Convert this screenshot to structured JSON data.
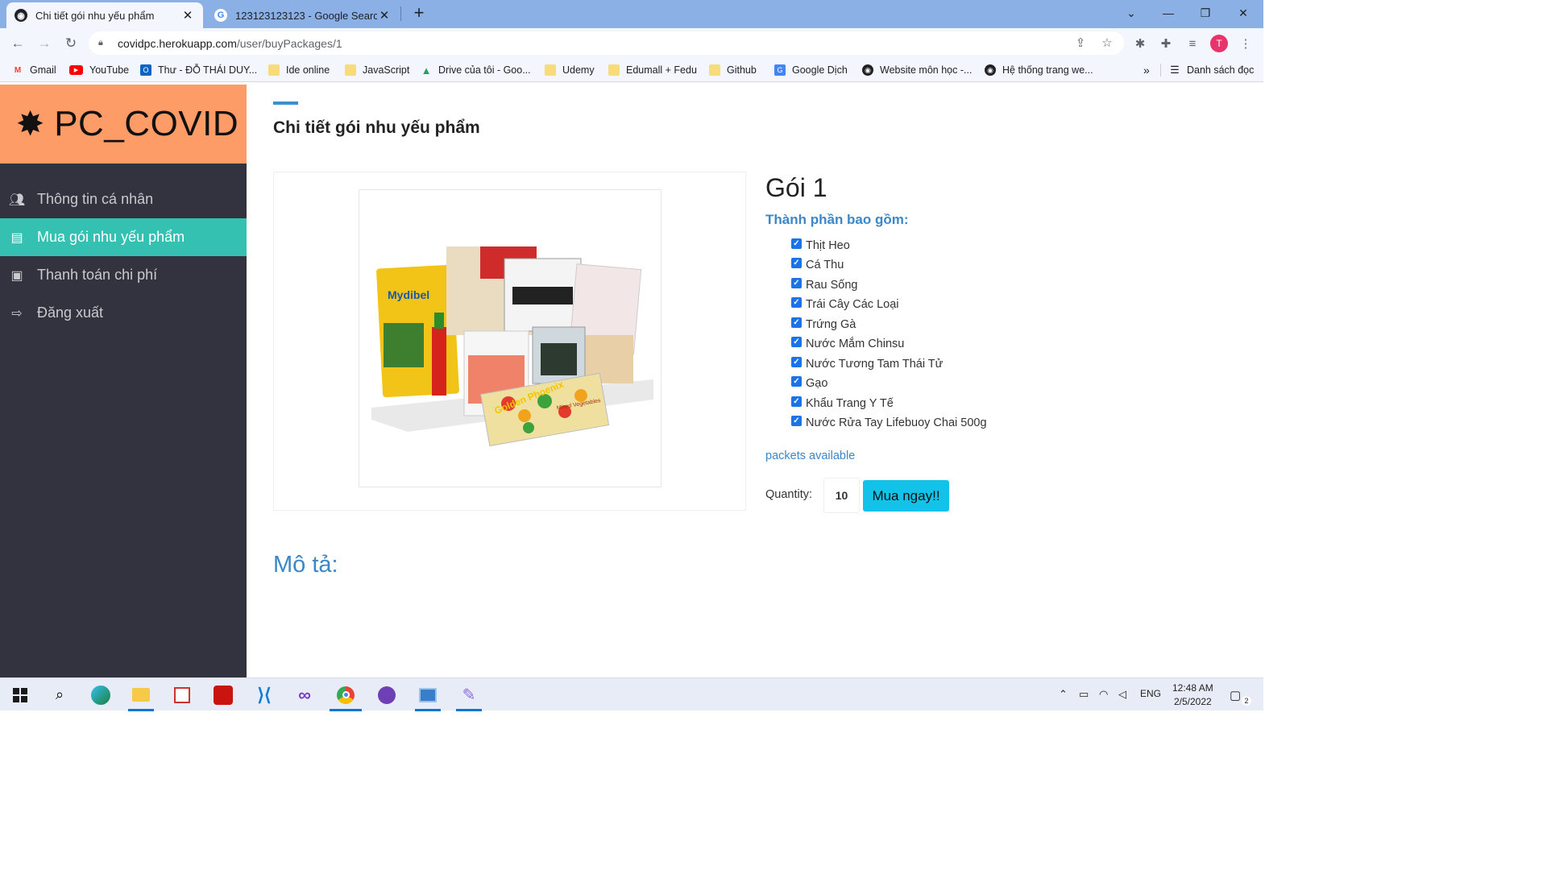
{
  "browser": {
    "tabs": [
      {
        "title": "Chi tiết gói nhu yếu phẩm",
        "active": true
      },
      {
        "title": "123123123123 - Google Search",
        "active": false
      }
    ],
    "new_tab": "+",
    "url_host": "covidpc.herokuapp.com",
    "url_path": "/user/buyPackages/1",
    "profile_initial": "T",
    "bookmarks": [
      {
        "label": "Gmail",
        "icon": "gmail-icon"
      },
      {
        "label": "YouTube",
        "icon": "youtube-icon"
      },
      {
        "label": "Thư - ĐỖ THÁI DUY...",
        "icon": "outlook-icon"
      },
      {
        "label": "Ide online",
        "icon": "folder-icon"
      },
      {
        "label": "JavaScript",
        "icon": "folder-icon"
      },
      {
        "label": "Drive của tôi - Goo...",
        "icon": "drive-icon"
      },
      {
        "label": "Udemy",
        "icon": "folder-icon"
      },
      {
        "label": "Edumall + Fedu",
        "icon": "folder-icon"
      },
      {
        "label": "Github",
        "icon": "folder-icon"
      },
      {
        "label": "Google Dịch",
        "icon": "translate-icon"
      },
      {
        "label": "Website môn học -...",
        "icon": "globe-icon"
      },
      {
        "label": "Hệ thống trang we...",
        "icon": "globe-icon"
      }
    ],
    "more": "»",
    "reading_list": "Danh sách đọc"
  },
  "sidebar": {
    "brand": "PC_COVID",
    "items": [
      {
        "label": "Thông tin cá nhân",
        "icon": "users-icon",
        "active": false
      },
      {
        "label": "Mua gói nhu yếu phẩm",
        "icon": "archive-icon",
        "active": true
      },
      {
        "label": "Thanh toán chi phí",
        "icon": "money-icon",
        "active": false
      },
      {
        "label": "Đăng xuất",
        "icon": "signout-icon",
        "active": false
      }
    ]
  },
  "main": {
    "page_title": "Chi tiết gói nhu yếu phẩm",
    "package_name": "Gói 1",
    "components_label": "Thành phần bao gồm:",
    "components": [
      "Thịt Heo",
      "Cá Thu",
      "Rau Sống",
      "Trái Cây Các Loại",
      "Trứng Gà",
      "Nước Mắm Chinsu",
      "Nước Tương Tam Thái Tử",
      "Gạo",
      "Khẩu Trang Y Tế",
      "Nước Rửa Tay Lifebuoy Chai 500g"
    ],
    "availability": "packets available",
    "quantity_label": "Quantity:",
    "quantity_value": "10",
    "buy_button": "Mua ngay!!",
    "description_label": "Mô tả:",
    "image_labels": {
      "mydibel": "Mydibel",
      "golden": "Golden Phoenix",
      "mixed": "Mixed Vegetables"
    }
  },
  "taskbar": {
    "lang": "ENG",
    "time": "12:48 AM",
    "date": "2/5/2022",
    "notifications": "2"
  },
  "colors": {
    "brand_bg": "#fe9c67",
    "sidebar_bg": "#32333f",
    "active_item": "#34c1b2",
    "link_blue": "#3b87c8",
    "buy_button": "#12c2e9"
  }
}
